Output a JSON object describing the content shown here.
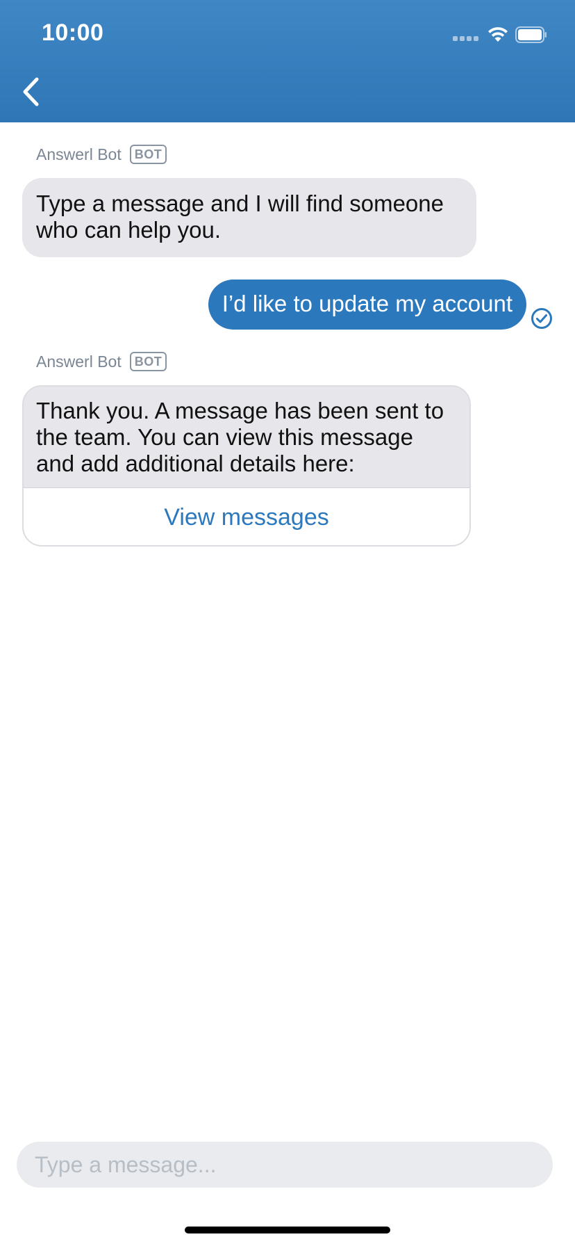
{
  "status_bar": {
    "time": "10:00"
  },
  "nav": {
    "back_icon": "chevron-left-icon"
  },
  "messages": [
    {
      "sender": "Answerl Bot",
      "badge": "BOT",
      "text": "Type a message and I will find someone who can help you."
    },
    {
      "outgoing_text": "I’d like to update my account",
      "status_icon": "check-circle-icon"
    },
    {
      "sender": "Answerl Bot",
      "badge": "BOT",
      "text": "Thank you. A message has been sent to the team. You can view this message and add additional details here:",
      "action_label": "View messages"
    }
  ],
  "composer": {
    "placeholder": "Type a message..."
  },
  "colors": {
    "header": "#3f87c5",
    "accent": "#2c78bd",
    "incoming_bubble": "#e6e6eb"
  }
}
